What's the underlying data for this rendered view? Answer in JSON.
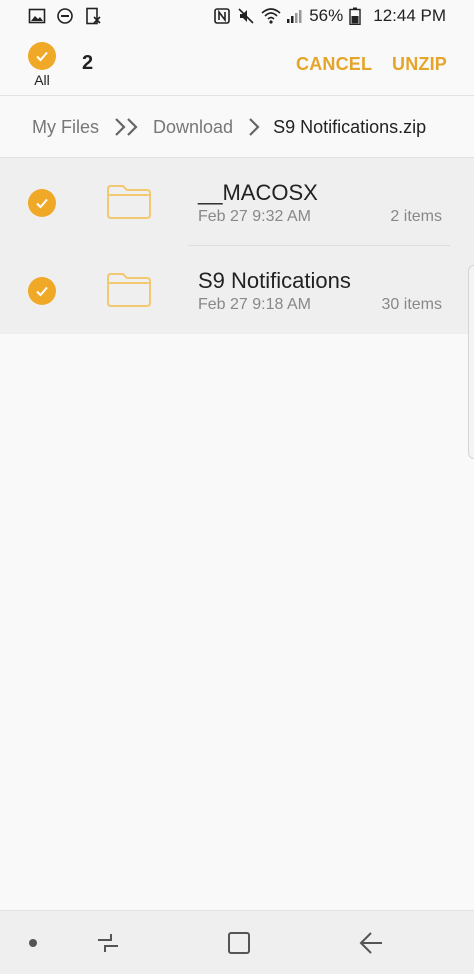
{
  "status_bar": {
    "battery_percent": "56%",
    "time": "12:44 PM",
    "left_icons": [
      "gallery-icon",
      "do-not-disturb-icon",
      "screenshot-icon"
    ],
    "right_icons": [
      "nfc-icon",
      "mute-icon",
      "wifi-icon",
      "signal-icon",
      "battery-icon"
    ]
  },
  "action_bar": {
    "select_all_label": "All",
    "selected_count": "2",
    "cancel_label": "CANCEL",
    "unzip_label": "UNZIP",
    "accent_color": "#e5a42a"
  },
  "breadcrumb": {
    "items": [
      "My Files",
      "Download",
      "S9 Notifications.zip"
    ]
  },
  "files": [
    {
      "name": "__MACOSX",
      "date": "Feb 27 9:32 AM",
      "count": "2 items",
      "checked": true
    },
    {
      "name": "S9 Notifications",
      "date": "Feb 27 9:18 AM",
      "count": "30 items",
      "checked": true
    }
  ],
  "nav_bar": {
    "buttons": [
      "recents-icon",
      "home-icon",
      "back-icon"
    ]
  }
}
